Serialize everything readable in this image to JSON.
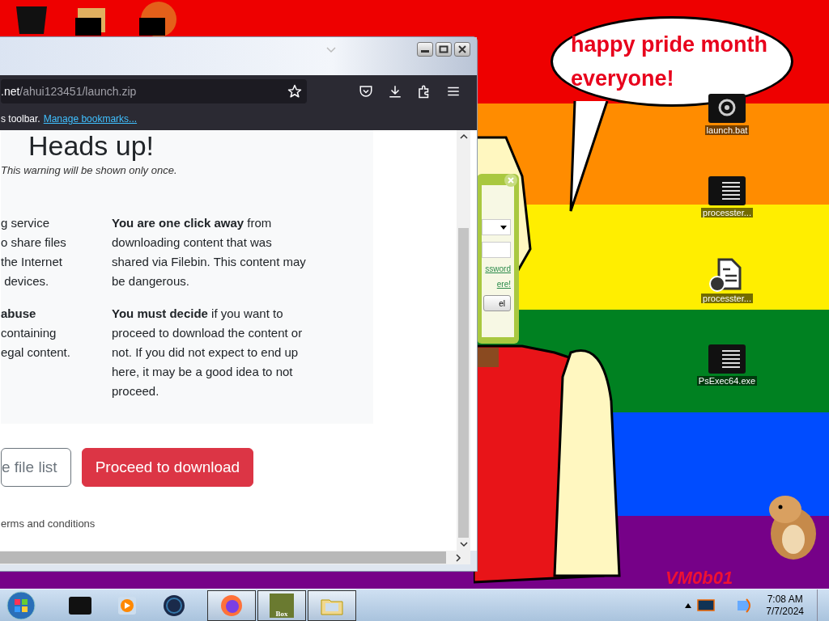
{
  "desktop": {
    "bubble_text": "happy pride month everyone!",
    "corner_label": "VM0b01",
    "icons": [
      {
        "label": "launch.bat",
        "kind": "gear"
      },
      {
        "label": "processter...",
        "kind": "lines"
      },
      {
        "label": "processter...",
        "kind": "doc"
      },
      {
        "label": "PsExec64.exe",
        "kind": "lines"
      }
    ]
  },
  "dialog": {
    "link_1": "ssword",
    "link_2": "ere!",
    "button": "el"
  },
  "browser": {
    "url_host": ".net",
    "url_path": "/ahui123451/launch.zip",
    "bookmarks_text": "s toolbar.",
    "bookmarks_link": "Manage bookmarks...",
    "heading": "Heads up!",
    "subtitle": "This warning will be shown only once.",
    "left_paragraphs": [
      [
        "g service",
        "o share files",
        "the Internet",
        " devices."
      ],
      [
        "**abuse**",
        "containing",
        "egal content."
      ]
    ],
    "right_paragraphs": [
      "**You are one click away** from downloading content that was shared via Filebin. This content may be dangerous.",
      "**You must decide** if you want to proceed to download the content or not. If you did not expect to end up here, it may be a good idea to not proceed."
    ],
    "buttons": [
      {
        "label": "e file list",
        "kind": "outline"
      },
      {
        "label": "Proceed to download",
        "kind": "danger"
      }
    ],
    "footer": "erms and conditions"
  },
  "taskbar": {
    "app_label": "Box",
    "time": "7:08 AM",
    "date": "7/7/2024"
  }
}
